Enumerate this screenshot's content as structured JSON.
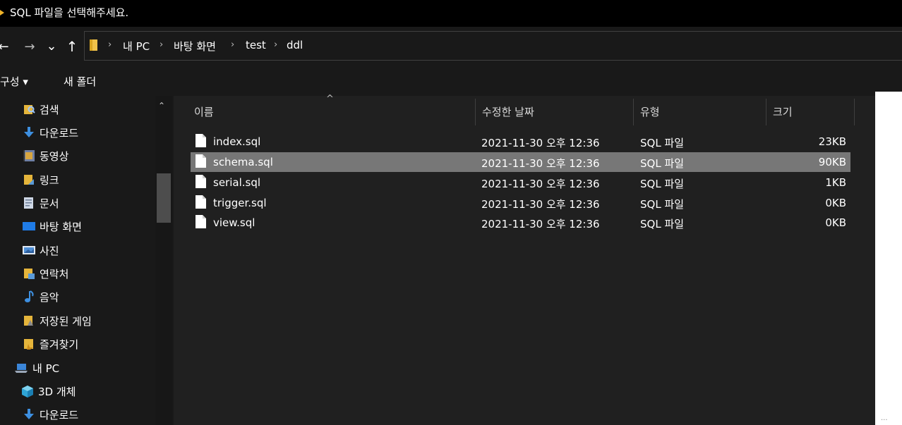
{
  "window": {
    "title": "SQL 파일을 선택해주세요.",
    "accent_color": "#f0b429"
  },
  "nav": {
    "back_icon": "back-arrow-icon",
    "forward_icon": "forward-arrow-icon",
    "recent_icon": "chevron-down-icon",
    "up_icon": "up-arrow-icon",
    "back_glyph": "←",
    "forward_glyph": "→",
    "recent_glyph": "⌄",
    "up_glyph": "↑"
  },
  "breadcrumb": {
    "items": [
      "내 PC",
      "바탕 화면",
      "test",
      "ddl"
    ],
    "separator": "›"
  },
  "commands": {
    "organize": "구성 ▾",
    "new_folder": "새 폴더"
  },
  "sidebar": {
    "items": [
      {
        "label": "검색",
        "icon": "search-folder-icon"
      },
      {
        "label": "다운로드",
        "icon": "download-icon"
      },
      {
        "label": "동영상",
        "icon": "video-icon"
      },
      {
        "label": "링크",
        "icon": "links-icon"
      },
      {
        "label": "문서",
        "icon": "document-icon"
      },
      {
        "label": "바탕 화면",
        "icon": "desktop-icon"
      },
      {
        "label": "사진",
        "icon": "pictures-icon"
      },
      {
        "label": "연락처",
        "icon": "contacts-icon"
      },
      {
        "label": "음악",
        "icon": "music-icon"
      },
      {
        "label": "저장된 게임",
        "icon": "saved-games-icon"
      },
      {
        "label": "즐겨찾기",
        "icon": "favorites-icon"
      },
      {
        "label": "내 PC",
        "icon": "computer-icon"
      },
      {
        "label": "3D 개체",
        "icon": "3d-objects-icon"
      },
      {
        "label": "다운로드",
        "icon": "download-icon"
      }
    ],
    "scroll_up_glyph": "⌃"
  },
  "filelist": {
    "sort_caret": "^",
    "columns": [
      "이름",
      "수정한 날짜",
      "유형",
      "크기"
    ],
    "selected_index": 1,
    "rows": [
      {
        "name": "index.sql",
        "date": "2021-11-30 오후 12:36",
        "type": "SQL 파일",
        "size": "23KB"
      },
      {
        "name": "schema.sql",
        "date": "2021-11-30 오후 12:36",
        "type": "SQL 파일",
        "size": "90KB"
      },
      {
        "name": "serial.sql",
        "date": "2021-11-30 오후 12:36",
        "type": "SQL 파일",
        "size": "1KB"
      },
      {
        "name": "trigger.sql",
        "date": "2021-11-30 오후 12:36",
        "type": "SQL 파일",
        "size": "0KB"
      },
      {
        "name": "view.sql",
        "date": "2021-11-30 오후 12:36",
        "type": "SQL 파일",
        "size": "0KB"
      }
    ]
  },
  "edge_ellipsis": "..."
}
